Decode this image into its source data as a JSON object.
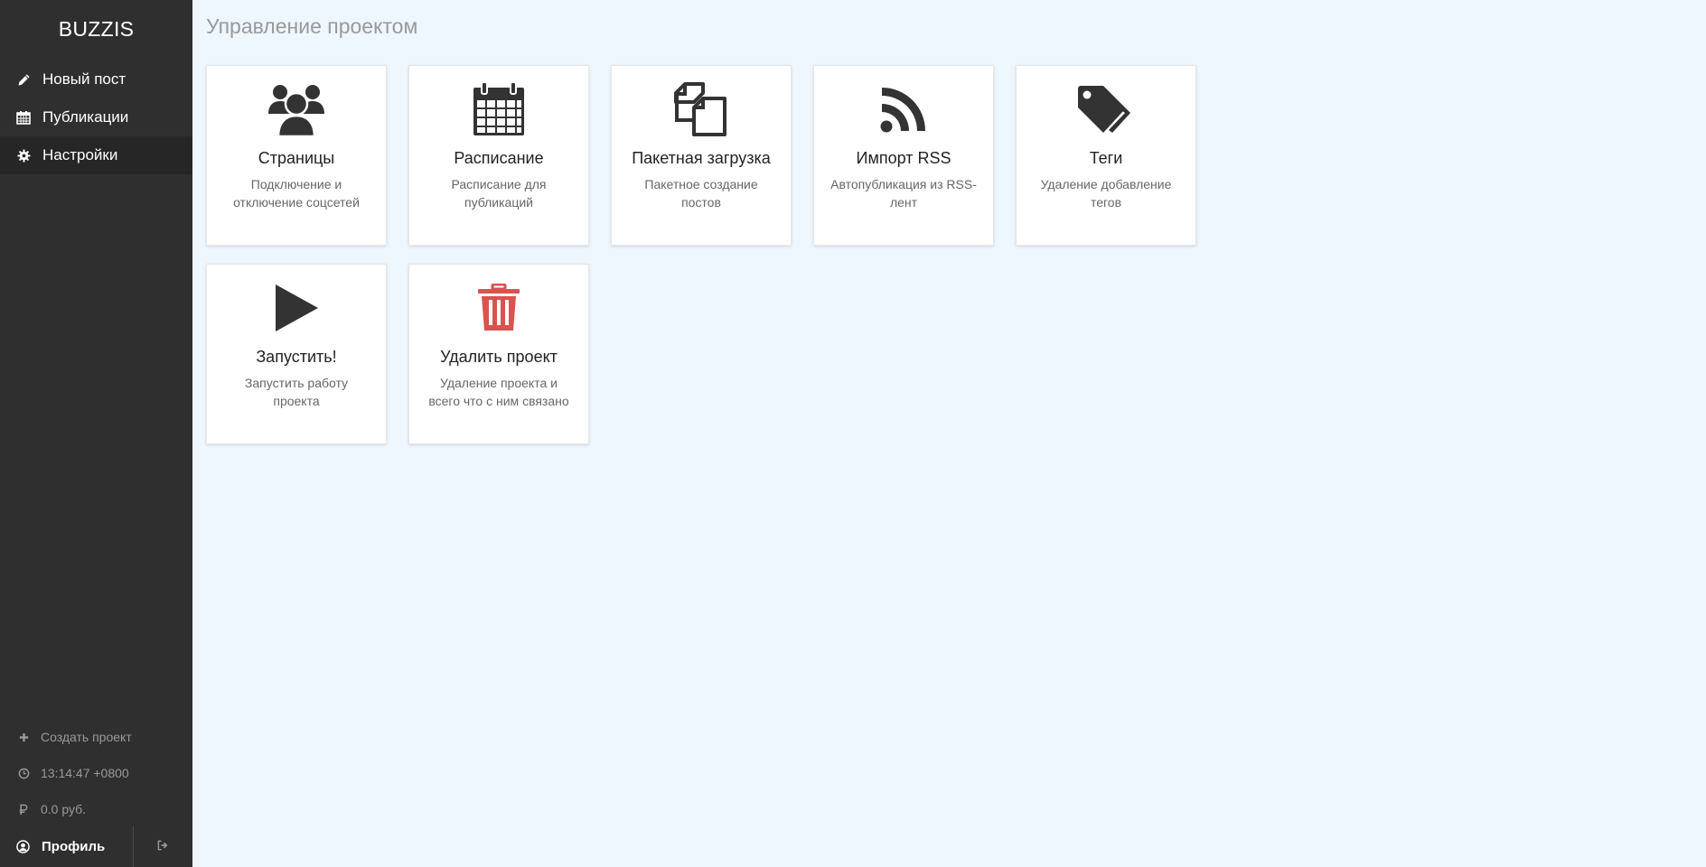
{
  "sidebar": {
    "brand": "BUZZIS",
    "nav": [
      {
        "label": "Новый пост",
        "icon": "pencil-icon"
      },
      {
        "label": "Публикации",
        "icon": "calendar-icon"
      },
      {
        "label": "Настройки",
        "icon": "gear-icon",
        "active": true
      }
    ],
    "footer": {
      "create_project": "Создать проект",
      "time": "13:14:47 +0800",
      "balance": "0.0 руб.",
      "profile": "Профиль"
    }
  },
  "main": {
    "title": "Управление проектом",
    "cards": [
      {
        "title": "Страницы",
        "desc": "Подключение и отключение соцсетей",
        "icon": "users-icon"
      },
      {
        "title": "Расписание",
        "desc": "Расписание для публикаций",
        "icon": "calendar-icon"
      },
      {
        "title": "Пакетная загрузка",
        "desc": "Пакетное создание постов",
        "icon": "files-icon"
      },
      {
        "title": "Импорт RSS",
        "desc": "Автопубликация из RSS-лент",
        "icon": "rss-icon"
      },
      {
        "title": "Теги",
        "desc": "Удаление добавление тегов",
        "icon": "tags-icon"
      },
      {
        "title": "Запустить!",
        "desc": "Запустить работу проекта",
        "icon": "play-icon"
      },
      {
        "title": "Удалить проект",
        "desc": "Удаление проекта и всего что с ним связано",
        "icon": "trash-icon"
      }
    ]
  },
  "colors": {
    "sidebar_bg": "#2f2f2f",
    "sidebar_active_bg": "#262626",
    "page_bg": "#eef6fe",
    "icon_dark": "#333333",
    "icon_danger": "#d9534f"
  }
}
